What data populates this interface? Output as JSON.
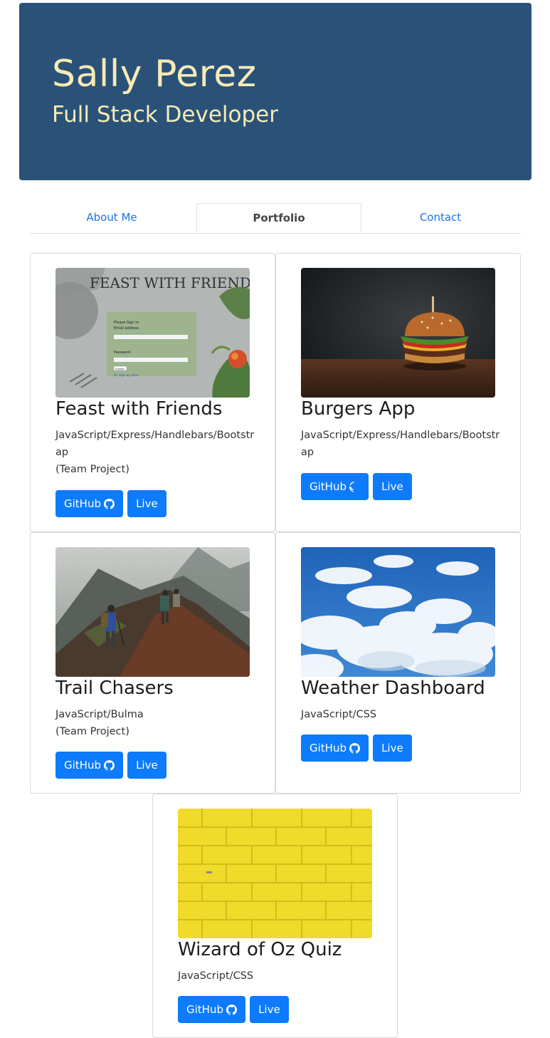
{
  "header": {
    "name": "Sally Perez",
    "role": "Full Stack Developer"
  },
  "nav": {
    "tabs": [
      {
        "label": "About Me",
        "active": false
      },
      {
        "label": "Portfolio",
        "active": true
      },
      {
        "label": "Contact",
        "active": false
      }
    ]
  },
  "colors": {
    "hero_bg": "#2a5279",
    "hero_text": "#f7eab5",
    "button_bg": "#0d7bfb",
    "link": "#1a73e8"
  },
  "projects": [
    {
      "title": "Feast with Friends",
      "tech": "JavaScript/Express/Handlebars/Bootstrap",
      "note": "(Team Project)",
      "github_label": "GitHub",
      "live_label": "Live",
      "image": "feast-screenshot",
      "image_text": {
        "banner": "FEAST WITH FRIENDS",
        "form_title": "Please Sign in",
        "email_label": "Email address",
        "password_label": "Password",
        "submit": "Submit",
        "signup": "Or sign up here"
      }
    },
    {
      "title": "Burgers App",
      "tech": "JavaScript/Express/Handlebars/Bootstrap",
      "note": "",
      "github_label": "GitHub",
      "live_label": "Live",
      "image": "burger-photo"
    },
    {
      "title": "Trail Chasers",
      "tech": "JavaScript/Bulma",
      "note": "(Team Project)",
      "github_label": "GitHub",
      "live_label": "Live",
      "image": "hikers-photo"
    },
    {
      "title": "Weather Dashboard",
      "tech": "JavaScript/CSS",
      "note": "",
      "github_label": "GitHub",
      "live_label": "Live",
      "image": "clouds-photo"
    },
    {
      "title": "Wizard of Oz Quiz",
      "tech": "JavaScript/CSS",
      "note": "",
      "github_label": "GitHub",
      "live_label": "Live",
      "image": "yellow-brick-photo"
    }
  ]
}
